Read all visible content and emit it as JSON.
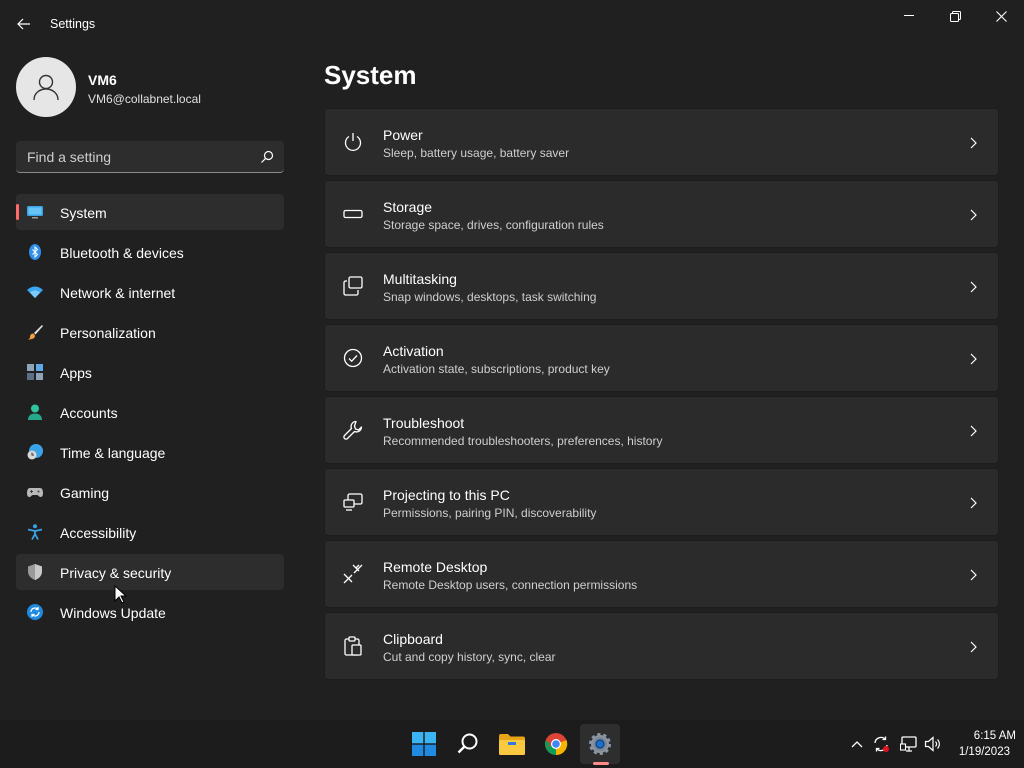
{
  "window": {
    "title": "Settings"
  },
  "profile": {
    "name": "VM6",
    "email": "VM6@collabnet.local"
  },
  "search": {
    "placeholder": "Find a setting"
  },
  "sidebar": {
    "items": [
      {
        "label": "System",
        "icon": "monitor-icon",
        "selected": true
      },
      {
        "label": "Bluetooth & devices",
        "icon": "bluetooth-icon"
      },
      {
        "label": "Network & internet",
        "icon": "wifi-icon"
      },
      {
        "label": "Personalization",
        "icon": "brush-icon"
      },
      {
        "label": "Apps",
        "icon": "apps-icon"
      },
      {
        "label": "Accounts",
        "icon": "person-icon"
      },
      {
        "label": "Time & language",
        "icon": "globe-clock-icon"
      },
      {
        "label": "Gaming",
        "icon": "gamepad-icon"
      },
      {
        "label": "Accessibility",
        "icon": "accessibility-icon"
      },
      {
        "label": "Privacy & security",
        "icon": "shield-icon",
        "hover": true
      },
      {
        "label": "Windows Update",
        "icon": "update-icon"
      }
    ]
  },
  "main": {
    "title": "System",
    "cards": [
      {
        "title": "Power",
        "subtitle": "Sleep, battery usage, battery saver",
        "icon": "power-icon"
      },
      {
        "title": "Storage",
        "subtitle": "Storage space, drives, configuration rules",
        "icon": "drive-icon"
      },
      {
        "title": "Multitasking",
        "subtitle": "Snap windows, desktops, task switching",
        "icon": "multitask-icon"
      },
      {
        "title": "Activation",
        "subtitle": "Activation state, subscriptions, product key",
        "icon": "check-circle-icon"
      },
      {
        "title": "Troubleshoot",
        "subtitle": "Recommended troubleshooters, preferences, history",
        "icon": "wrench-icon"
      },
      {
        "title": "Projecting to this PC",
        "subtitle": "Permissions, pairing PIN, discoverability",
        "icon": "project-icon"
      },
      {
        "title": "Remote Desktop",
        "subtitle": "Remote Desktop users, connection permissions",
        "icon": "remote-desktop-icon"
      },
      {
        "title": "Clipboard",
        "subtitle": "Cut and copy history, sync, clear",
        "icon": "clipboard-icon"
      }
    ]
  },
  "taskbar": {
    "time": "6:15 AM",
    "date": "1/19/2023"
  },
  "colors": {
    "background": "#202020",
    "card": "#2b2b2b",
    "selected_indicator": "#ff6b6b",
    "accent_blue": "#0a84ff"
  }
}
